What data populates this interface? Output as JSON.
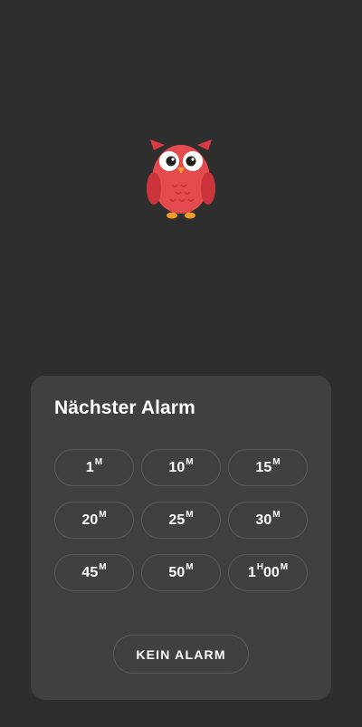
{
  "mascot": {
    "icon": "owl-icon"
  },
  "sheet": {
    "title": "Nächster Alarm",
    "options": [
      {
        "num": "1",
        "unit": "M"
      },
      {
        "num": "10",
        "unit": "M"
      },
      {
        "num": "15",
        "unit": "M"
      },
      {
        "num": "20",
        "unit": "M"
      },
      {
        "num": "25",
        "unit": "M"
      },
      {
        "num": "30",
        "unit": "M"
      },
      {
        "num": "45",
        "unit": "M"
      },
      {
        "num": "50",
        "unit": "M"
      },
      {
        "num": "1",
        "unit": "H",
        "num2": "00",
        "unit2": "M"
      }
    ],
    "no_alarm_label": "KEIN ALARM"
  },
  "colors": {
    "background": "#2e2e2e",
    "sheet": "#404040",
    "owl_red": "#e34b4f",
    "owl_feet": "#f29a27"
  }
}
